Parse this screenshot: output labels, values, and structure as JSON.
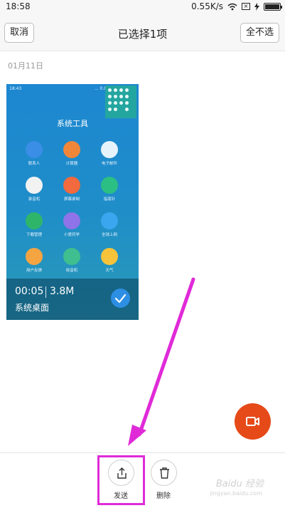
{
  "status_bar": {
    "time": "18:58",
    "network_speed": "0.55K/s",
    "battery_icon": "battery-icon"
  },
  "header": {
    "cancel_label": "取消",
    "title": "已选择1项",
    "deselect_all_label": "全不选"
  },
  "gallery": {
    "date_label": "01月11日",
    "item": {
      "duration": "00:05",
      "size": "3.8M",
      "name": "系统桌面",
      "selected": true,
      "thumbnail": {
        "status_time": "18:43",
        "status_right": "... 0.04K/s",
        "folder_title": "系统工具",
        "apps": [
          {
            "label": "联系人",
            "color": "#3a8ee6"
          },
          {
            "label": "计算器",
            "color": "#f0863a"
          },
          {
            "label": "电子邮件",
            "color": "#e7f3fb"
          },
          {
            "label": "录音机",
            "color": "#f2f2f2"
          },
          {
            "label": "屏幕录制",
            "color": "#f26a3d"
          },
          {
            "label": "指南针",
            "color": "#2bbf83"
          },
          {
            "label": "下载管理",
            "color": "#2fb56a"
          },
          {
            "label": "小爱同学",
            "color": "#8e74e8"
          },
          {
            "label": "全球上网",
            "color": "#3aa6f0"
          },
          {
            "label": "用户反馈",
            "color": "#f5a442"
          },
          {
            "label": "收音机",
            "color": "#3fbf8f"
          },
          {
            "label": "天气",
            "color": "#f6c33b"
          }
        ]
      }
    }
  },
  "fab": {
    "icon": "video-camera-icon",
    "color": "#e64a19"
  },
  "bottom_actions": {
    "send_label": "发送",
    "delete_label": "删除"
  },
  "watermark": {
    "text": "Baidu 经验",
    "sub": "jingyan.baidu.com"
  },
  "annotation": {
    "color": "#e02ad8"
  }
}
